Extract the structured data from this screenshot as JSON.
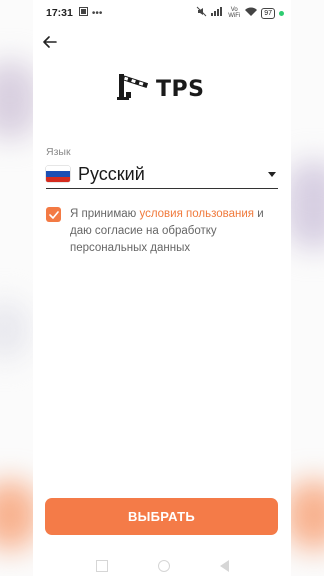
{
  "status_bar": {
    "time": "17:31",
    "battery": "97",
    "network_label": "Vo WiFi"
  },
  "logo": {
    "text": "TPS",
    "icon": "barrier-gate-icon"
  },
  "language": {
    "label": "Язык",
    "value": "Русский",
    "flag_colors": [
      "#ffffff",
      "#1c4fb4",
      "#d52b1e"
    ]
  },
  "consent": {
    "checked": true,
    "text_before": "Я принимаю ",
    "link_text": "условия пользования",
    "text_after": " и даю согласие на обработку персональных данных"
  },
  "primary_button": {
    "label": "ВЫБРАТЬ"
  },
  "colors": {
    "accent": "#f47b48",
    "link": "#f07a3c"
  }
}
